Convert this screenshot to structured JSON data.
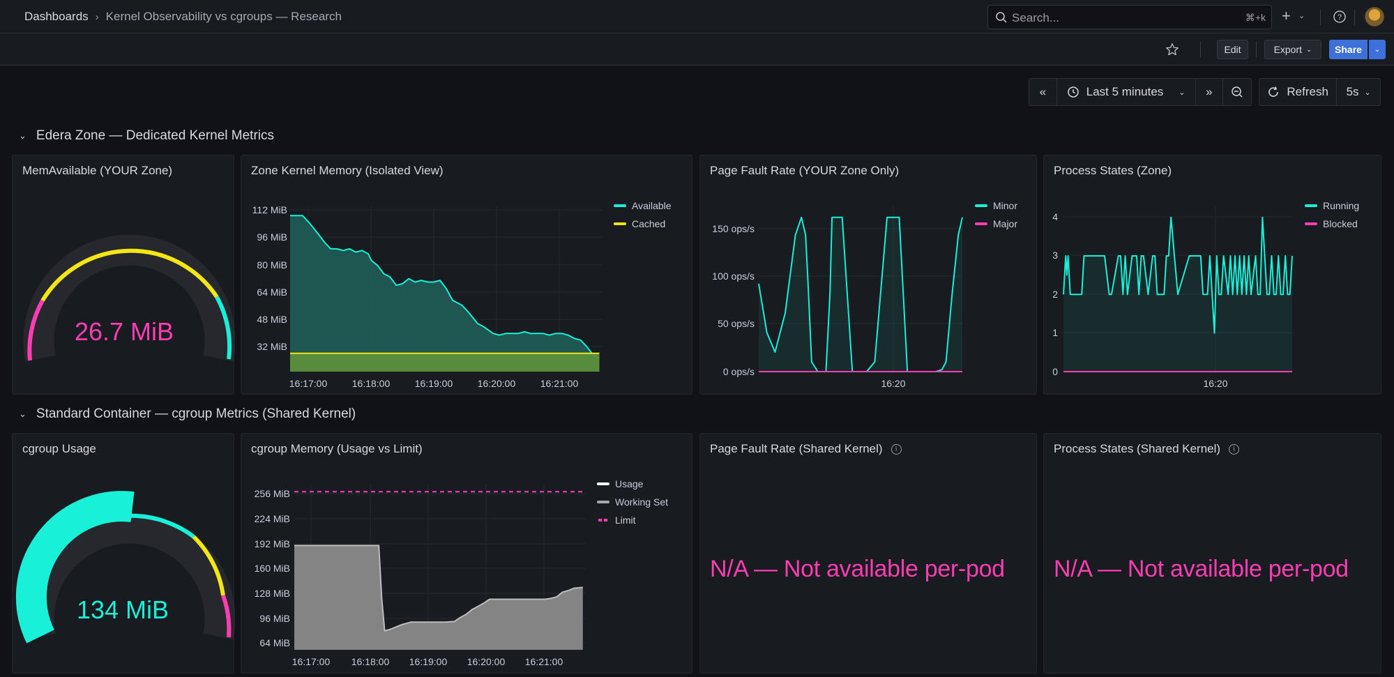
{
  "breadcrumb": {
    "home": "Dashboards",
    "separator": "›",
    "current": "Kernel Observability vs cgroups — Research"
  },
  "search": {
    "placeholder": "Search...",
    "shortcut": "⌘+k"
  },
  "toolbar": {
    "edit": "Edit",
    "export": "Export",
    "share": "Share"
  },
  "timepicker": {
    "range": "Last 5 minutes",
    "refresh": "Refresh",
    "interval": "5s"
  },
  "rows": [
    {
      "title": "Edera Zone — Dedicated Kernel Metrics"
    },
    {
      "title": "Standard Container — cgroup Metrics (Shared Kernel)"
    }
  ],
  "panels": {
    "zone_gauge": {
      "title": "MemAvailable (YOUR Zone)",
      "value": "26.7 MiB",
      "color": "#ff3db2"
    },
    "zone_mem": {
      "title": "Zone Kernel Memory (Isolated View)"
    },
    "zone_pf": {
      "title": "Page Fault Rate (YOUR Zone Only)"
    },
    "zone_ps": {
      "title": "Process States (Zone)"
    },
    "cg_gauge": {
      "title": "cgroup Usage",
      "value": "134 MiB",
      "color": "#19f0d8"
    },
    "cg_mem": {
      "title": "cgroup Memory (Usage vs Limit)"
    },
    "shared_pf": {
      "title": "Page Fault Rate (Shared Kernel)",
      "message": "N/A — Not available per-pod"
    },
    "shared_ps": {
      "title": "Process States (Shared Kernel)",
      "message": "N/A — Not available per-pod"
    }
  },
  "chart_data": [
    {
      "type": "area",
      "title": "Zone Kernel Memory (Isolated View)",
      "y_ticks": [
        "112 MiB",
        "96 MiB",
        "80 MiB",
        "64 MiB",
        "48 MiB",
        "32 MiB"
      ],
      "x_ticks": [
        "16:17:00",
        "16:18:00",
        "16:19:00",
        "16:20:00",
        "16:21:00"
      ],
      "ylim": [
        18,
        118
      ],
      "xlim": [
        0,
        5
      ],
      "legend": "top-right",
      "series": [
        {
          "name": "Available",
          "color": "#19f0d8",
          "x": [
            0,
            0.2,
            0.3,
            0.45,
            0.55,
            0.65,
            0.75,
            0.85,
            0.95,
            1.05,
            1.15,
            1.25,
            1.3,
            1.4,
            1.5,
            1.6,
            1.7,
            1.8,
            1.9,
            2.0,
            2.1,
            2.2,
            2.3,
            2.4,
            2.5,
            2.6,
            2.75,
            2.85,
            3.0,
            3.1,
            3.25,
            3.35,
            3.45,
            3.55,
            3.65,
            3.75,
            3.85,
            3.95,
            4.05,
            4.15,
            4.25,
            4.35,
            4.45,
            4.55,
            4.65,
            4.75,
            4.85,
            4.95
          ],
          "values": [
            112,
            112,
            108,
            101,
            96,
            92,
            92,
            91,
            92,
            90,
            91,
            89,
            85,
            82,
            77,
            75,
            70,
            71,
            74,
            72,
            73,
            72,
            72,
            73,
            68,
            61,
            58,
            54,
            47,
            45,
            41,
            40,
            41,
            41,
            41,
            42,
            41,
            41,
            41,
            40,
            41,
            41,
            40,
            38,
            37,
            33,
            28,
            26
          ]
        },
        {
          "name": "Cached",
          "color": "#f2e614",
          "x": [
            0,
            4.95
          ],
          "values": [
            29,
            29
          ]
        }
      ]
    },
    {
      "type": "line",
      "title": "Page Fault Rate (YOUR Zone Only)",
      "y_ticks": [
        "150 ops/s",
        "100 ops/s",
        "50 ops/s",
        "0 ops/s"
      ],
      "x_ticks": [
        "16:20"
      ],
      "ylim": [
        0,
        170
      ],
      "xlim": [
        0,
        100
      ],
      "legend": "top-right",
      "series": [
        {
          "name": "Minor",
          "color": "#19f0d8",
          "x": [
            0,
            4,
            8,
            13,
            18,
            21,
            23,
            24,
            26,
            29,
            33,
            35,
            36,
            41,
            46,
            49,
            53,
            57,
            63,
            69,
            73,
            76,
            80,
            82,
            84,
            87,
            90,
            92,
            95,
            98,
            100
          ],
          "values": [
            90,
            40,
            20,
            60,
            140,
            158,
            140,
            100,
            10,
            0,
            0,
            80,
            158,
            158,
            0,
            0,
            0,
            10,
            158,
            158,
            0,
            0,
            0,
            0,
            0,
            0,
            2,
            10,
            80,
            140,
            158
          ]
        },
        {
          "name": "Major",
          "color": "#ff3db2",
          "x": [
            0,
            100
          ],
          "values": [
            0,
            0
          ]
        }
      ]
    },
    {
      "type": "line",
      "title": "Process States (Zone)",
      "y_ticks": [
        "4",
        "3",
        "2",
        "1",
        "0"
      ],
      "x_ticks": [
        "16:20"
      ],
      "ylim": [
        0,
        4.3
      ],
      "xlim": [
        0,
        100
      ],
      "legend": "top-right",
      "series": [
        {
          "name": "Running",
          "color": "#19f0d8",
          "x": [
            0,
            1,
            1.5,
            2,
            3,
            5,
            8,
            9,
            12,
            18,
            20,
            21,
            24,
            25,
            26,
            27,
            28,
            30,
            32,
            33,
            34,
            35,
            37,
            39,
            40,
            41,
            44,
            45,
            46,
            47,
            50,
            55,
            56,
            60,
            61,
            62,
            63,
            64,
            65,
            66,
            67,
            68,
            69,
            70,
            72,
            73,
            74,
            75,
            76,
            77,
            78,
            79,
            80,
            81,
            82,
            84,
            85,
            86,
            87,
            88,
            89,
            90,
            91,
            92,
            93,
            94,
            95,
            96,
            97,
            98,
            99,
            100
          ],
          "values": [
            2,
            3,
            2.5,
            3,
            2,
            2,
            2,
            3,
            3,
            3,
            2,
            2,
            3,
            3,
            2,
            3,
            2,
            3,
            3,
            2,
            3,
            3,
            2,
            3,
            3,
            2,
            2,
            3,
            3,
            4,
            2,
            3,
            3,
            3,
            2,
            2,
            2,
            3,
            2,
            1,
            3,
            2,
            2,
            3,
            2,
            3,
            2,
            3,
            2,
            3,
            2,
            3,
            2,
            3,
            2,
            3,
            2,
            2,
            4,
            3,
            2,
            2,
            3,
            2,
            2,
            3,
            2,
            2,
            3,
            2,
            2,
            3
          ]
        },
        {
          "name": "Blocked",
          "color": "#ff3db2",
          "x": [
            0,
            100
          ],
          "values": [
            0,
            0
          ]
        }
      ]
    },
    {
      "type": "area",
      "title": "cgroup Memory (Usage vs Limit)",
      "y_ticks": [
        "256 MiB",
        "224 MiB",
        "192 MiB",
        "160 MiB",
        "128 MiB",
        "96 MiB",
        "64 MiB"
      ],
      "x_ticks": [
        "16:17:00",
        "16:18:00",
        "16:19:00",
        "16:20:00",
        "16:21:00"
      ],
      "ylim": [
        56,
        266
      ],
      "xlim": [
        0,
        5
      ],
      "legend": "top-right",
      "series": [
        {
          "name": "Usage",
          "color": "#ffffff",
          "x": [
            0,
            1.45,
            1.5,
            1.55,
            1.65,
            1.75,
            1.85,
            2.0,
            2.3,
            2.6,
            2.75,
            2.85,
            2.95,
            3.05,
            3.15,
            3.25,
            3.35,
            3.5,
            3.8,
            4.1,
            4.3,
            4.4,
            4.5,
            4.6,
            4.7,
            4.8,
            4.95
          ],
          "values": [
            188,
            188,
            121,
            80,
            82,
            85,
            88,
            91,
            91,
            91,
            92,
            97,
            101,
            107,
            111,
            115,
            120,
            120,
            120,
            120,
            120,
            121,
            123,
            129,
            131,
            134,
            135
          ]
        },
        {
          "name": "Working Set",
          "color": "#a8a8a8",
          "x": [],
          "values": []
        },
        {
          "name": "Limit",
          "color": "#ff3db2",
          "x": [
            0,
            4.95
          ],
          "values": [
            256,
            256
          ]
        }
      ]
    },
    {
      "type": "gauge",
      "title": "MemAvailable (YOUR Zone)",
      "value": 26.7,
      "thresholds": [
        {
          "color": "#ff3db2",
          "from": 0,
          "to": 0.24
        },
        {
          "color": "#f2e614",
          "from": 0.24,
          "to": 0.86
        },
        {
          "color": "#19f0d8",
          "from": 0.86,
          "to": 1
        }
      ]
    },
    {
      "type": "gauge",
      "title": "cgroup Usage",
      "value": 134,
      "fill_fraction": 0.53,
      "thresholds": [
        {
          "color": "#19f0d8",
          "from": 0,
          "to": 0.73
        },
        {
          "color": "#f2e614",
          "from": 0.73,
          "to": 0.91
        },
        {
          "color": "#ff3db2",
          "from": 0.91,
          "to": 1
        }
      ]
    }
  ]
}
